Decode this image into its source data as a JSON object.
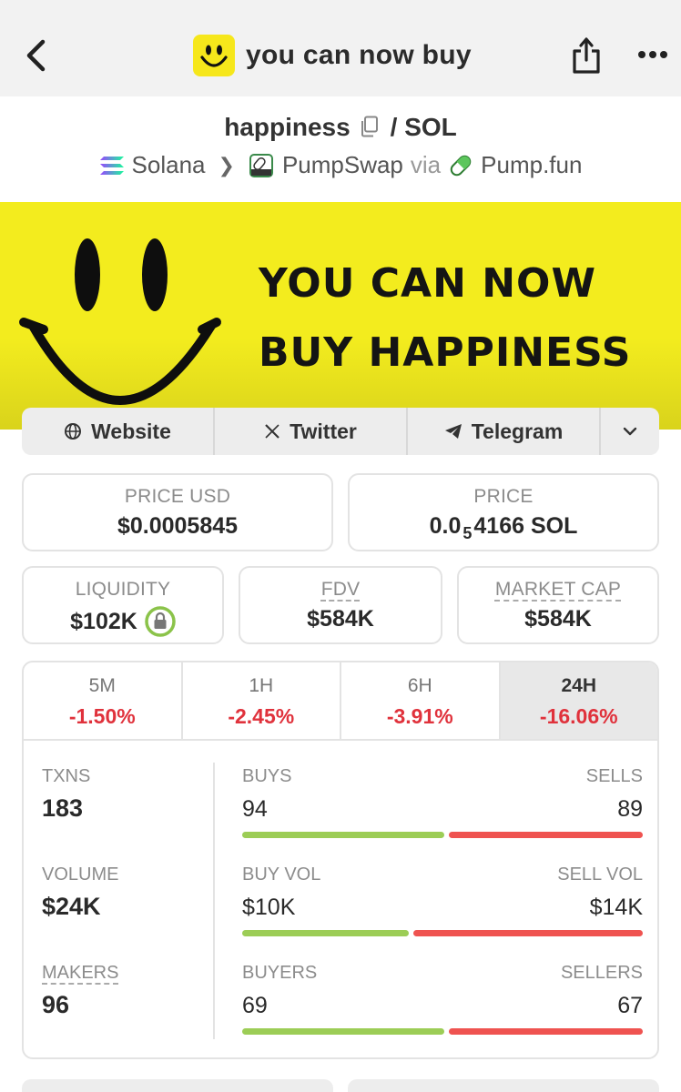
{
  "header": {
    "title": "you can now buy",
    "back_icon": "chevron-left-icon",
    "share_icon": "share-icon",
    "more_icon": "more-dots-icon"
  },
  "pair": {
    "base": "happiness",
    "quote": "/ SOL",
    "chain": "Solana",
    "dex": "PumpSwap",
    "via": "via",
    "launchpad": "Pump.fun"
  },
  "banner": {
    "line1": "YOU CAN NOW",
    "line2": "BUY HAPPINESS",
    "background_color": "#f3ec1e"
  },
  "links": {
    "website": "Website",
    "twitter": "Twitter",
    "telegram": "Telegram"
  },
  "price": {
    "usd_label": "PRICE USD",
    "usd_value": "$0.0005845",
    "native_label": "PRICE",
    "native_prefix": "0.0",
    "native_subscript": "5",
    "native_suffix": "4166 SOL"
  },
  "metrics": {
    "liquidity_label": "LIQUIDITY",
    "liquidity_value": "$102K",
    "fdv_label": "FDV",
    "fdv_value": "$584K",
    "mcap_label": "MARKET CAP",
    "mcap_value": "$584K"
  },
  "timeframes": [
    {
      "label": "5M",
      "change": "-1.50%"
    },
    {
      "label": "1H",
      "change": "-2.45%"
    },
    {
      "label": "6H",
      "change": "-3.91%"
    },
    {
      "label": "24H",
      "change": "-16.06%"
    }
  ],
  "active_timeframe": "24H",
  "stats": {
    "txns_label": "TXNS",
    "txns_value": "183",
    "volume_label": "VOLUME",
    "volume_value": "$24K",
    "makers_label": "MAKERS",
    "makers_value": "96",
    "buys_label": "BUYS",
    "buys_value": "94",
    "sells_label": "SELLS",
    "sells_value": "89",
    "buy_share": 0.51,
    "buyvol_label": "BUY VOL",
    "buyvol_value": "$10K",
    "sellvol_label": "SELL VOL",
    "sellvol_value": "$14K",
    "buyvol_share": 0.42,
    "buyers_label": "BUYERS",
    "buyers_value": "69",
    "sellers_label": "SELLERS",
    "sellers_value": "67",
    "buyers_share": 0.51
  },
  "colors": {
    "negative": "#e0323c",
    "buy_bar": "#9ccd56",
    "sell_bar": "#ef5350"
  }
}
